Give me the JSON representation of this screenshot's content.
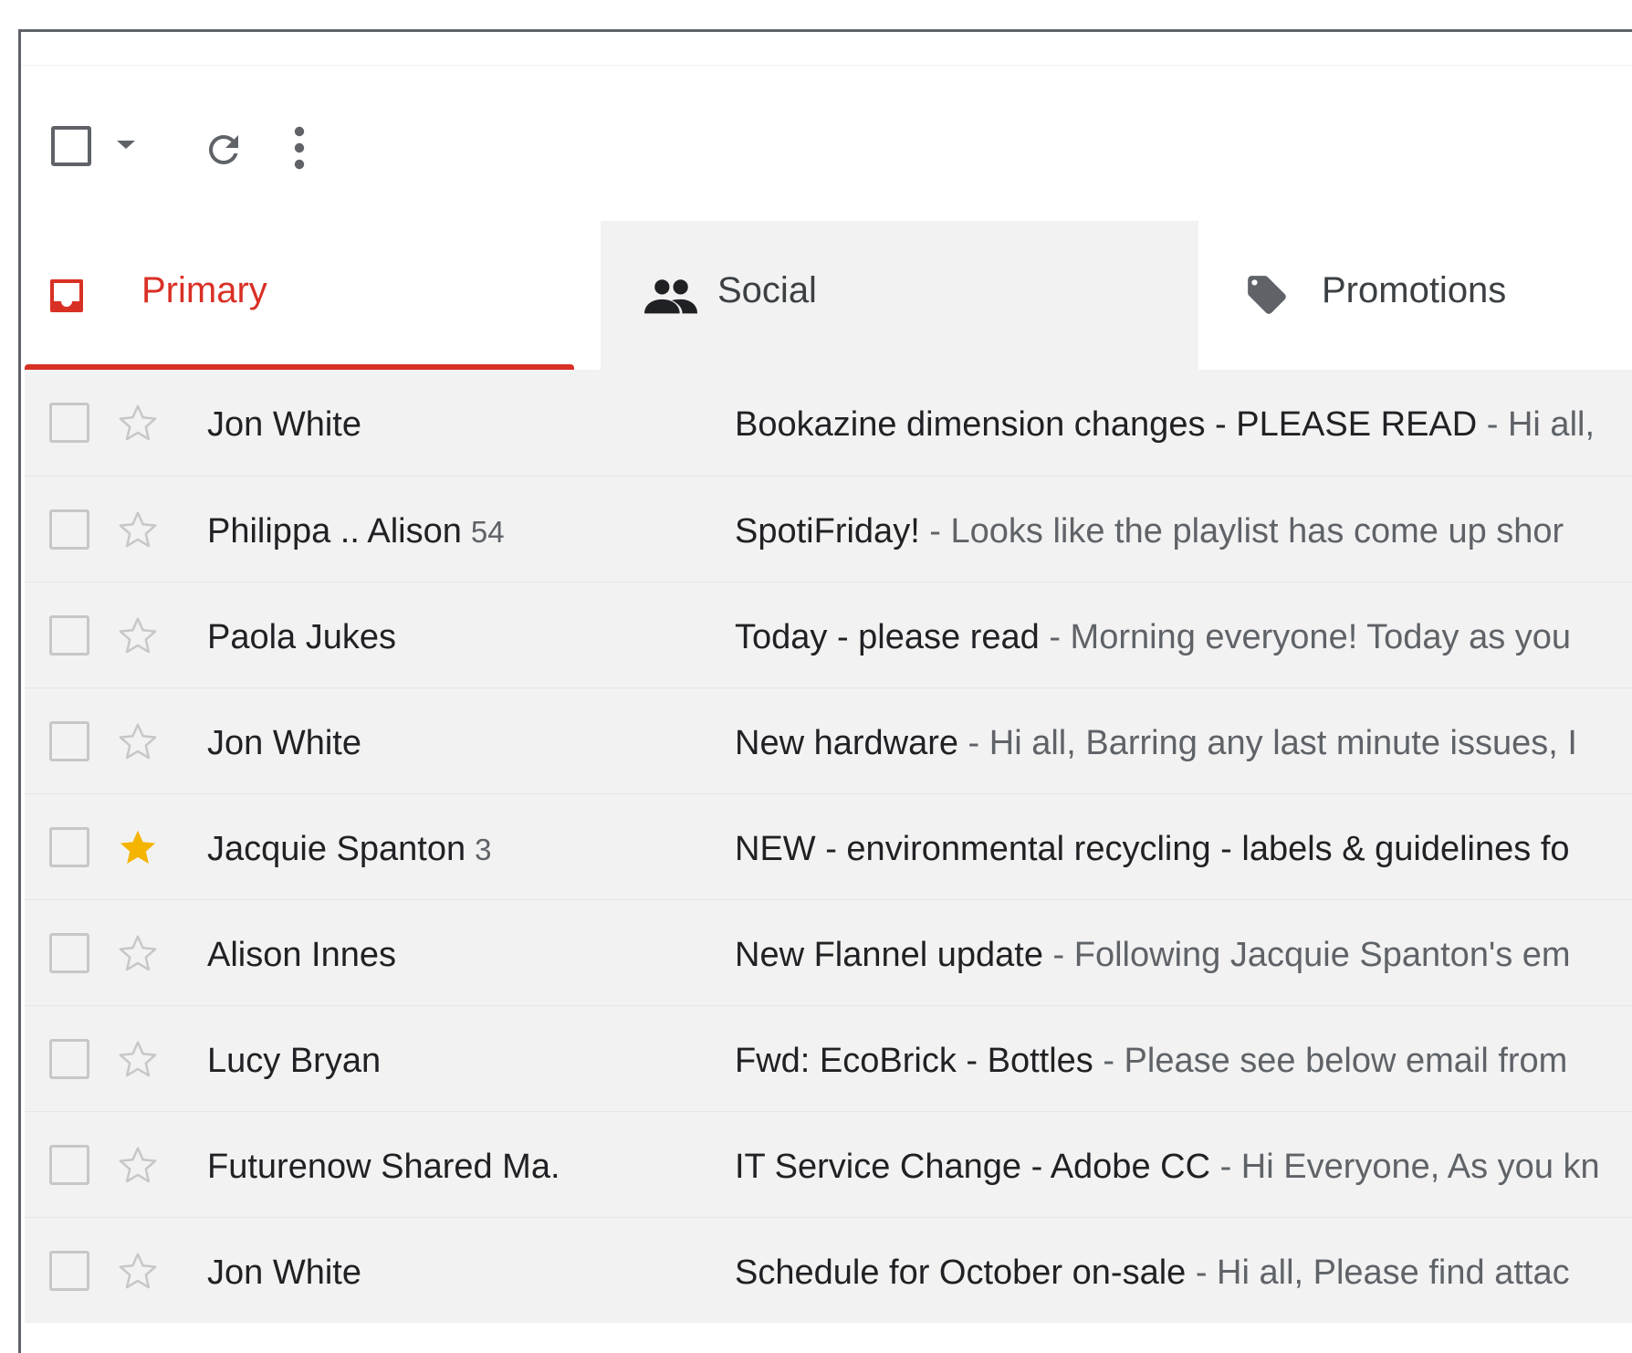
{
  "tabs": [
    {
      "label": "Primary",
      "icon": "inbox-icon",
      "selected": true
    },
    {
      "label": "Social",
      "icon": "people-icon",
      "selected": false
    },
    {
      "label": "Promotions",
      "icon": "tag-icon",
      "selected": false
    }
  ],
  "colors": {
    "accent": "#d93025",
    "star": "#f4b400",
    "row_bg": "#f2f2f2"
  },
  "emails": [
    {
      "sender": "Jon White",
      "count": "",
      "subject": "Bookazine dimension changes - PLEASE READ",
      "snippet": " - Hi all,",
      "starred": false
    },
    {
      "sender": "Philippa .. Alison",
      "count": "54",
      "subject": "SpotiFriday!",
      "snippet": " - Looks like the playlist has come up shor",
      "starred": false
    },
    {
      "sender": "Paola Jukes",
      "count": "",
      "subject": "Today - please read",
      "snippet": " - Morning everyone! Today as you",
      "starred": false
    },
    {
      "sender": "Jon White",
      "count": "",
      "subject": "New hardware",
      "snippet": " - Hi all, Barring any last minute issues, I",
      "starred": false
    },
    {
      "sender": "Jacquie Spanton",
      "count": "3",
      "subject": "NEW - environmental recycling - labels & guidelines fo",
      "snippet": "",
      "starred": true
    },
    {
      "sender": "Alison Innes",
      "count": "",
      "subject": "New Flannel update",
      "snippet": " - Following Jacquie Spanton's em",
      "starred": false
    },
    {
      "sender": "Lucy Bryan",
      "count": "",
      "subject": "Fwd: EcoBrick - Bottles",
      "snippet": " - Please see below email from",
      "starred": false
    },
    {
      "sender": "Futurenow Shared Ma.",
      "count": "",
      "subject": "IT Service Change - Adobe CC",
      "snippet": " - Hi Everyone, As you kn",
      "starred": false
    },
    {
      "sender": "Jon White",
      "count": "",
      "subject": "Schedule for October on-sale",
      "snippet": " - Hi all, Please find attac",
      "starred": false
    }
  ]
}
